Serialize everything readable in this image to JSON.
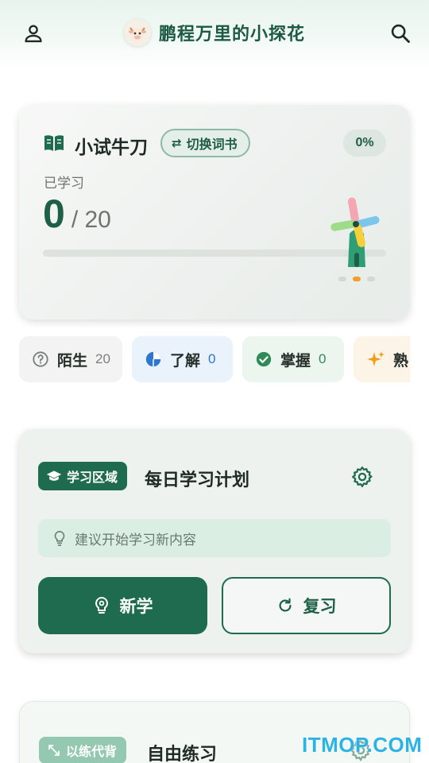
{
  "header": {
    "title": "鹏程万里的小探花",
    "left_icon": "person-icon",
    "right_icon": "search-icon"
  },
  "deck_card": {
    "title": "小试牛刀",
    "switch_label": "切换词书",
    "percent": "0%",
    "learned_label": "已学习",
    "learned_count": "0",
    "total_text": "/ 20",
    "progress": 0,
    "carousel_pages": 3,
    "carousel_active": 1
  },
  "chips": [
    {
      "label": "陌生",
      "count": "20",
      "icon": "question-circle-icon",
      "color": "#7a7f7c",
      "bg": "#f2f3f2"
    },
    {
      "label": "了解",
      "count": "0",
      "icon": "pie-chart-icon",
      "color": "#2f76d2",
      "bg": "#eaf2fc"
    },
    {
      "label": "掌握",
      "count": "0",
      "icon": "check-circle-icon",
      "color": "#2e8b57",
      "bg": "#edf5ef"
    },
    {
      "label": "熟",
      "count": "",
      "icon": "sparkle-icon",
      "color": "#f0a020",
      "bg": "#fdf4e8"
    }
  ],
  "plan_card": {
    "badge": "学习区域",
    "title": "每日学习计划",
    "tip": "建议开始学习新内容",
    "new_button": "新学",
    "review_button": "复习"
  },
  "free_card": {
    "badge": "以练代背",
    "title": "自由练习"
  },
  "watermark": "ITMOP.COM",
  "colors": {
    "primary": "#1e6b50",
    "accent_orange": "#f3a02a"
  }
}
